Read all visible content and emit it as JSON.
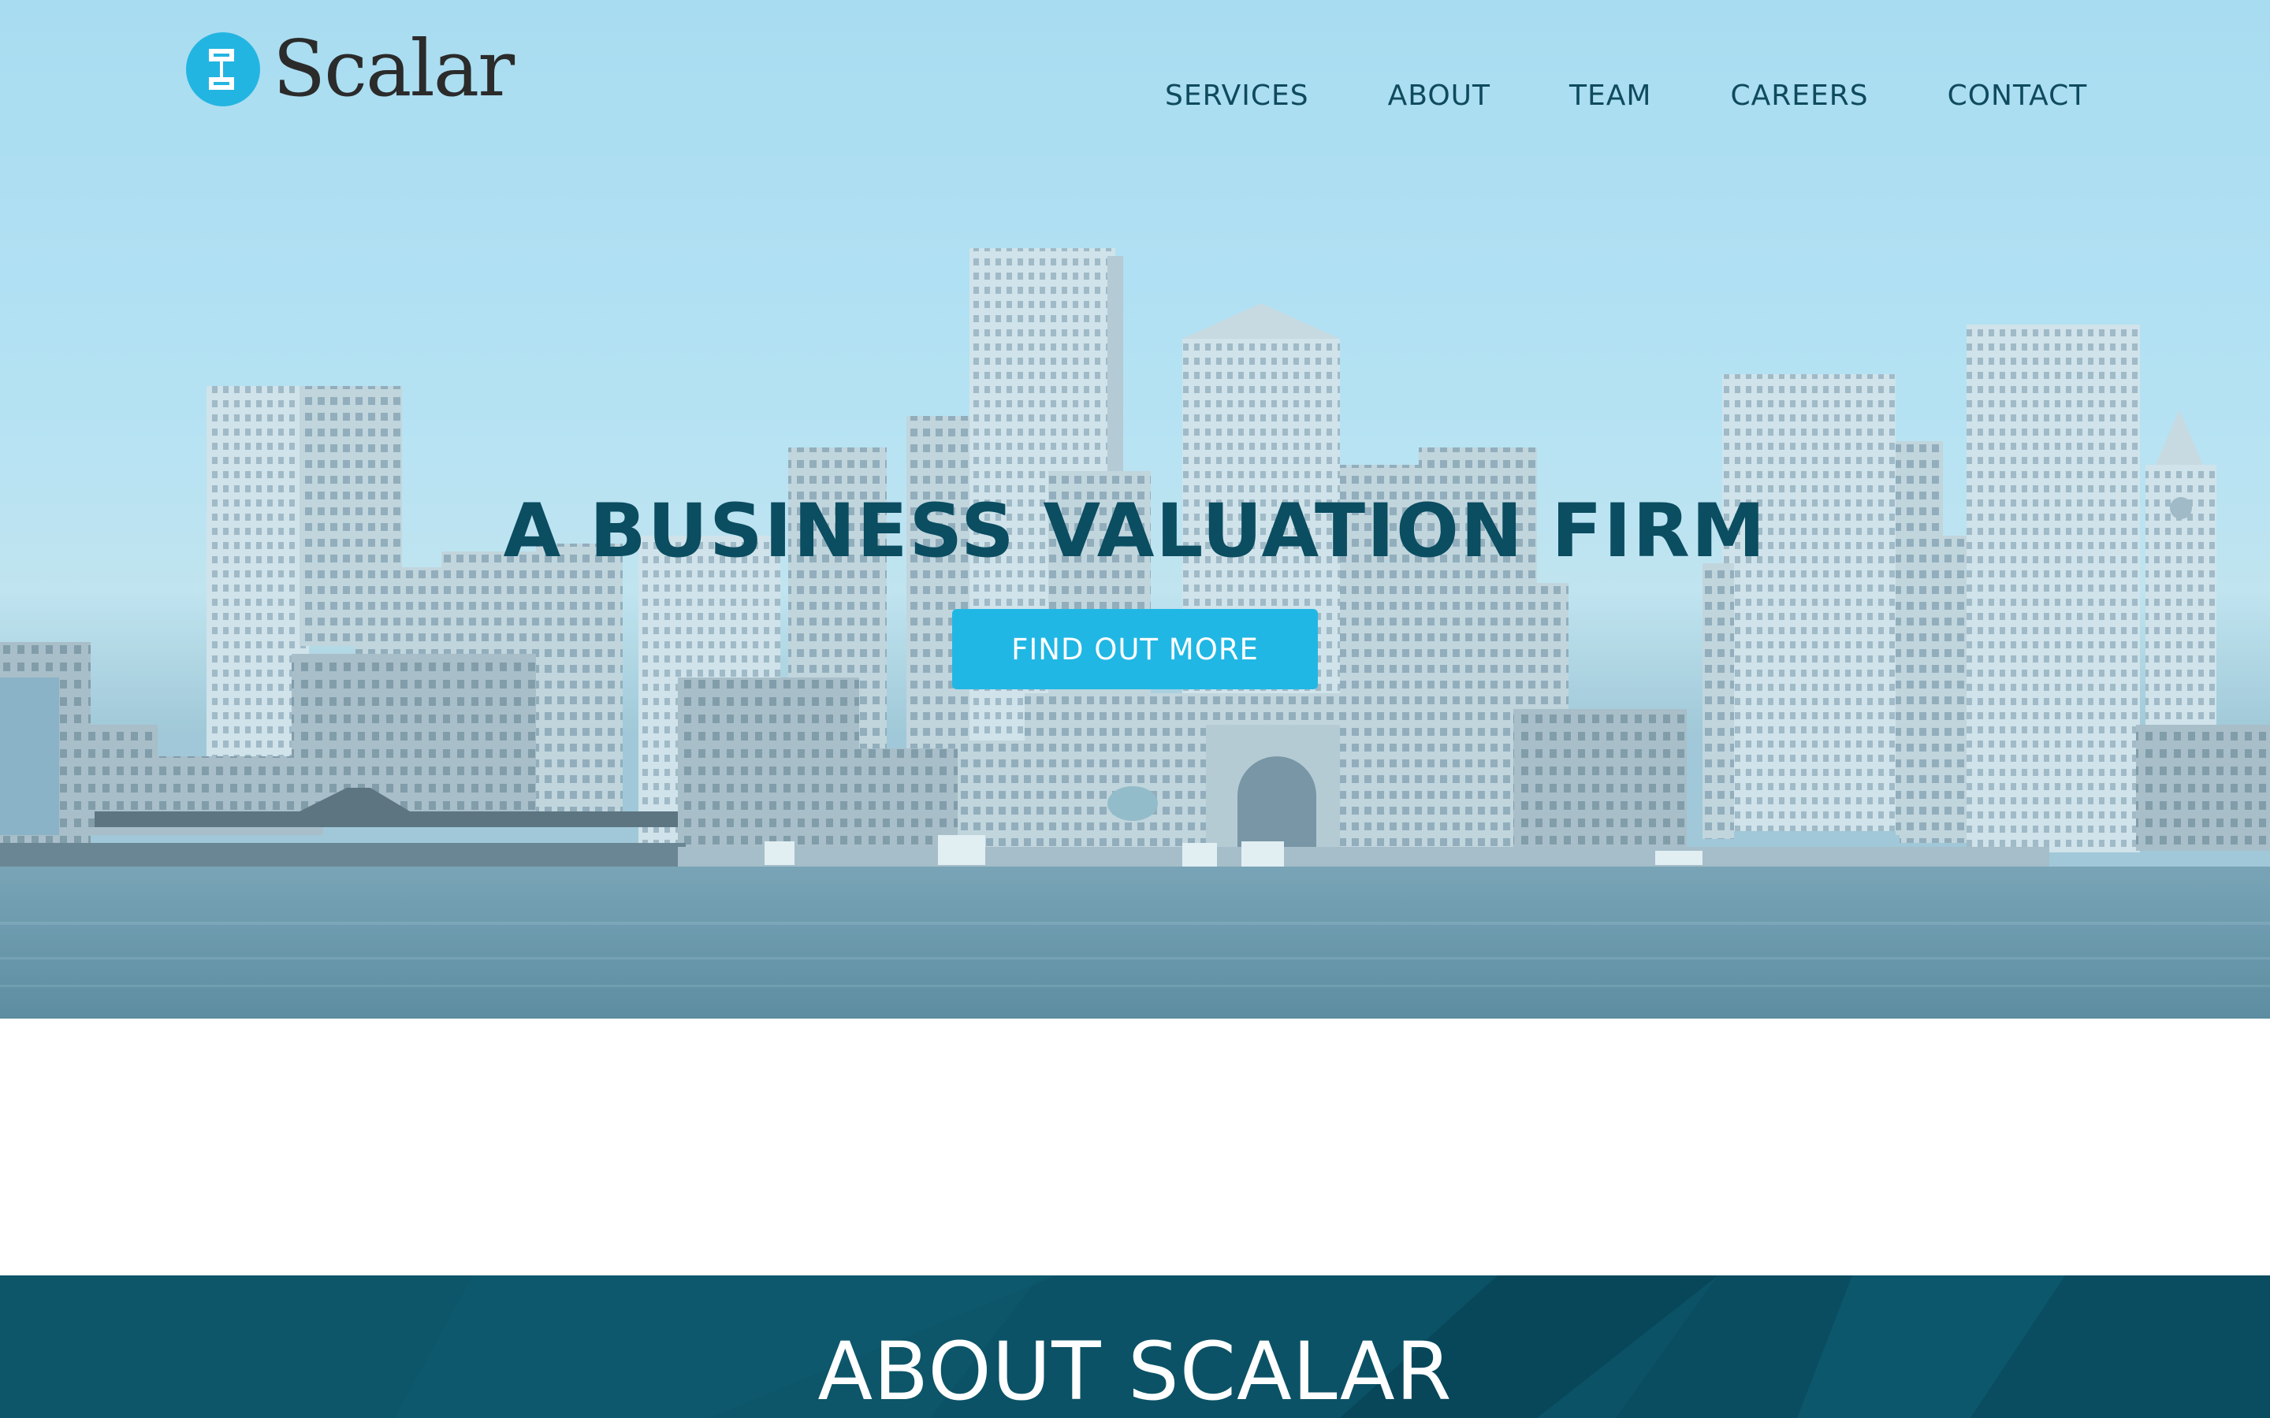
{
  "brand": {
    "name": "Scalar",
    "icon": "scalar-logo-icon",
    "accent_color": "#23b5e2"
  },
  "nav": {
    "items": [
      {
        "label": "SERVICES"
      },
      {
        "label": "ABOUT"
      },
      {
        "label": "TEAM"
      },
      {
        "label": "CAREERS"
      },
      {
        "label": "CONTACT"
      }
    ]
  },
  "hero": {
    "title": "A BUSINESS VALUATION FIRM",
    "cta_label": "FIND OUT MORE",
    "background": "city-skyline-waterfront-photo",
    "title_color": "#0b4d61",
    "cta_color": "#21b7e4"
  },
  "about": {
    "title": "ABOUT SCALAR",
    "background_color": "#0b5266"
  }
}
